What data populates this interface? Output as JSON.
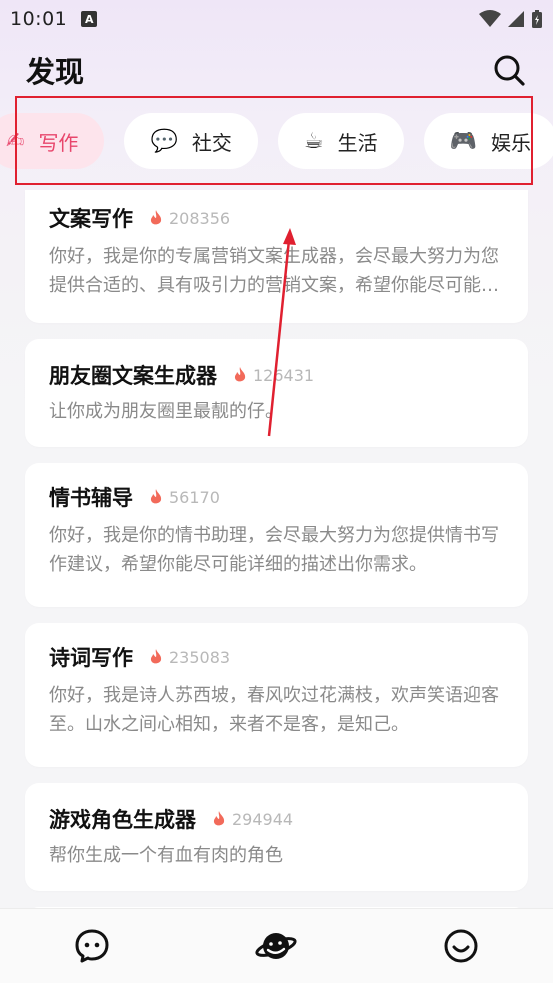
{
  "status_bar": {
    "time": "10:01",
    "notif": "A"
  },
  "header": {
    "title": "发现"
  },
  "tabs": [
    {
      "emoji": "✍",
      "label": "写作",
      "active": true
    },
    {
      "emoji": "💬",
      "label": "社交",
      "active": false
    },
    {
      "emoji": "☕",
      "label": "生活",
      "active": false
    },
    {
      "emoji": "🎮",
      "label": "娱乐",
      "active": false
    }
  ],
  "cards": [
    {
      "title": "文案写作",
      "count": "208356",
      "desc": "你好，我是你的专属营销文案生成器，会尽最大努力为您提供合适的、具有吸引力的营销文案，希望你能尽可能详细的描述出你的需求。"
    },
    {
      "title": "朋友圈文案生成器",
      "count": "126431",
      "desc": "让你成为朋友圈里最靓的仔。"
    },
    {
      "title": "情书辅导",
      "count": "56170",
      "desc": "你好，我是你的情书助理，会尽最大努力为您提供情书写作建议，希望你能尽可能详细的描述出你需求。"
    },
    {
      "title": "诗词写作",
      "count": "235083",
      "desc": "你好，我是诗人苏西坡，春风吹过花满枝，欢声笑语迎客至。山水之间心相知，来者不是客，是知己。"
    },
    {
      "title": "游戏角色生成器",
      "count": "294944",
      "desc": "帮你生成一个有血有肉的角色"
    }
  ],
  "colors": {
    "accent": "#e8466c",
    "annotation": "#e02030"
  }
}
